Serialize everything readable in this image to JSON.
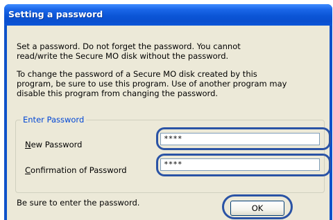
{
  "window": {
    "title": "Setting a password"
  },
  "message": {
    "paragraph1_line1": "Set a password. Do not forget the password. You cannot",
    "paragraph1_line2": "read/write the Secure MO disk without the password.",
    "paragraph2_line1": "To change the password of a Secure MO disk created by this",
    "paragraph2_line2": "program, be sure to use this program. Use of another program may",
    "paragraph2_line3": "disable this program from changing the password."
  },
  "password_group": {
    "legend": "Enter Password",
    "new_password": {
      "label_accel": "N",
      "label_rest": "ew Password",
      "value": "****"
    },
    "confirm_password": {
      "label_accel": "C",
      "label_rest": "onfirmation of Password",
      "value": "****"
    }
  },
  "footer": {
    "note": "Be sure to enter the password.",
    "ok_label": "OK"
  },
  "colors": {
    "title_bar": "#0b55d6",
    "client_background": "#ece9d8",
    "group_legend": "#0046d5",
    "highlight_oval": "#2a53a5"
  }
}
